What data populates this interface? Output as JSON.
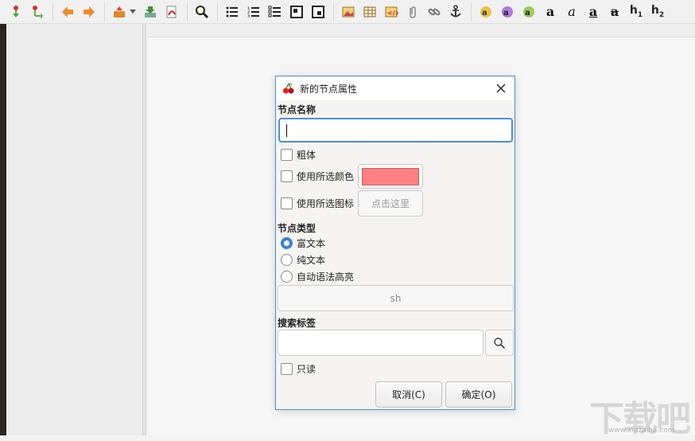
{
  "toolbar": {
    "groups": [
      [
        "add-node-icon",
        "add-subnode-icon"
      ],
      [
        "go-back-icon",
        "go-forward-icon"
      ],
      [
        "export-icon",
        "import-icon",
        "export-pdf-icon"
      ],
      [
        "find-icon"
      ],
      [
        "bulleted-list-icon",
        "numbered-list-icon",
        "todo-list-icon",
        "insert-toc-icon",
        "insert-codebox-icon"
      ],
      [
        "insert-image-icon",
        "insert-table-icon",
        "insert-code-icon",
        "insert-file-icon",
        "insert-link-icon",
        "insert-anchor-icon"
      ],
      [
        "color-fg-icon",
        "color-bg-icon",
        "bold-color-icon"
      ]
    ],
    "text_format": {
      "bold": "a",
      "italic": "a",
      "underline": "a",
      "strikethrough": "a",
      "h1": "h",
      "h1_sub": "1",
      "h2": "h",
      "h2_sub": "2"
    }
  },
  "dialog": {
    "title": "新的节点属性",
    "node_name_label": "节点名称",
    "node_name_value": "",
    "bold_label": "粗体",
    "use_color_label": "使用所选颜色",
    "selected_color": "#ff8080",
    "use_icon_label": "使用所选图标",
    "icon_button_label": "点击这里",
    "node_type_label": "节点类型",
    "node_types": [
      {
        "label": "富文本",
        "checked": true
      },
      {
        "label": "纯文本",
        "checked": false
      },
      {
        "label": "自动语法高亮",
        "checked": false
      }
    ],
    "syntax_language": "sh",
    "tags_label": "搜索标签",
    "tags_value": "",
    "readonly_label": "只读",
    "cancel_label": "取消(C)",
    "ok_label": "确定(O)"
  },
  "watermark": {
    "text": "下载吧",
    "url": "www.xiazaiba.com"
  },
  "colors": {
    "accent": "#3b82d4",
    "focus_border": "#4a90d9",
    "dialog_border": "#4a8ec9"
  }
}
